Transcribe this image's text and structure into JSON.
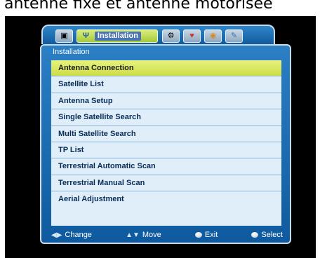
{
  "caption": "antenne fixe et antenne motorisée",
  "tabs": [
    {
      "icon": "dish-icon",
      "glyph": "▣"
    },
    {
      "icon": "antenna-icon",
      "glyph": "Ψ",
      "label": "Installation",
      "active": true
    },
    {
      "icon": "settings-icon",
      "glyph": "⚙"
    },
    {
      "icon": "heart-icon",
      "glyph": "♥"
    },
    {
      "icon": "media-icon",
      "glyph": "◉"
    },
    {
      "icon": "tools-icon",
      "glyph": "✎"
    }
  ],
  "panel": {
    "title": "Installation"
  },
  "menu": {
    "selected_index": 0,
    "items": [
      "Antenna Connection",
      "Satellite List",
      "Antenna Setup",
      "Single Satellite Search",
      "Multi Satellite Search",
      "TP List",
      "Terrestrial Automatic Scan",
      "Terrestrial Manual Scan",
      "Aerial Adjustment"
    ]
  },
  "footer": {
    "change": {
      "glyph": "◀▶",
      "label": "Change"
    },
    "move": {
      "glyph": "▲▼",
      "label": "Move"
    },
    "exit": {
      "label": "Exit"
    },
    "select": {
      "label": "Select"
    }
  }
}
